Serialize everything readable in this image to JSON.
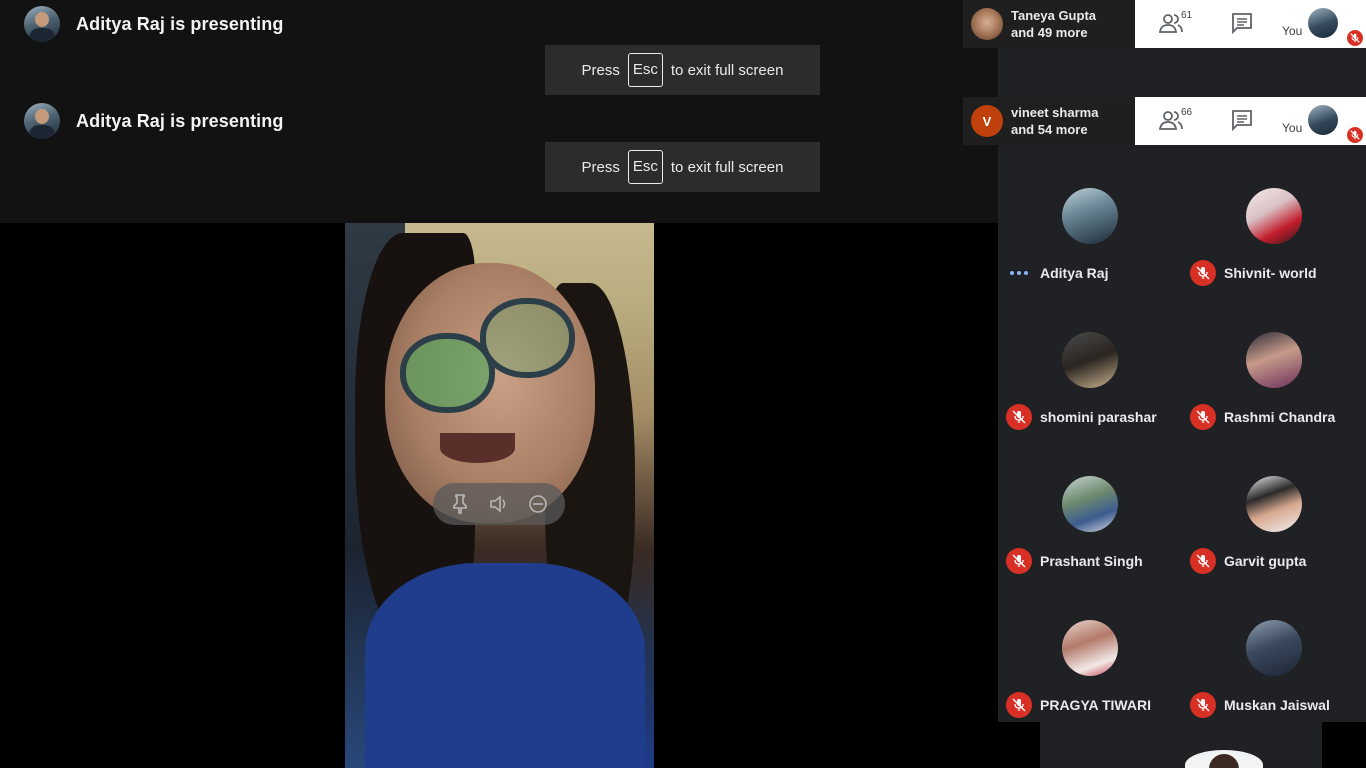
{
  "banners": [
    {
      "text": "Aditya Raj is presenting",
      "toast": {
        "before": "Press",
        "key": "Esc",
        "after": "to exit full screen"
      }
    },
    {
      "text": "Aditya Raj is presenting",
      "toast": {
        "before": "Press",
        "key": "Esc",
        "after": "to exit full screen"
      }
    }
  ],
  "call_bars": [
    {
      "speaker": "Taneya Gupta",
      "more": "and 49 more",
      "participants": "61",
      "you": "You"
    },
    {
      "speaker_initial": "V",
      "speaker": "vineet sharma",
      "more": "and 54 more",
      "participants": "66",
      "you": "You"
    }
  ],
  "participants": [
    {
      "name": "Aditya Raj",
      "status": "speaking"
    },
    {
      "name": "Shivnit- world",
      "status": "muted"
    },
    {
      "name": "shomini parashar",
      "status": "muted"
    },
    {
      "name": "Rashmi Chandra",
      "status": "muted"
    },
    {
      "name": "Prashant Singh",
      "status": "muted"
    },
    {
      "name": "Garvit gupta",
      "status": "muted"
    },
    {
      "name": "PRAGYA TIWARI",
      "status": "muted"
    },
    {
      "name": "Muskan Jaiswal",
      "status": "muted"
    }
  ],
  "video_controls": [
    "pin-icon",
    "volume-icon",
    "remove-icon"
  ],
  "colors": {
    "mic_muted": "#d93025",
    "panel": "#202124",
    "speaking_dots": "#8ab4f8",
    "vineet_avatar": "#c1410d"
  }
}
